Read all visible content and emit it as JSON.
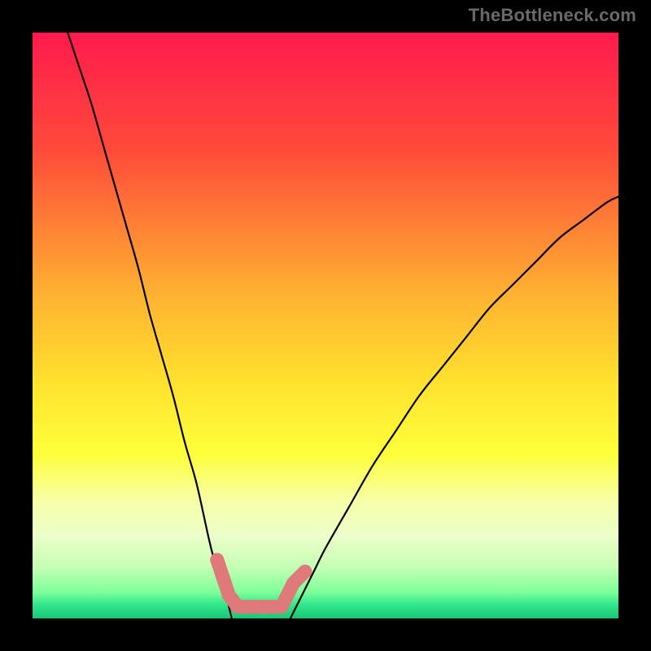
{
  "watermark": "TheBottleneck.com",
  "chart_data": {
    "type": "line",
    "title": "",
    "xlabel": "",
    "ylabel": "",
    "xlim": [
      0,
      100
    ],
    "ylim": [
      0,
      100
    ],
    "grid": false,
    "series": [
      {
        "name": "left-curve",
        "color": "#000000",
        "x": [
          6,
          8,
          10,
          12,
          14,
          16,
          18,
          20,
          22,
          24,
          26,
          28,
          30,
          31,
          32,
          33,
          34
        ],
        "y": [
          100,
          94,
          88,
          81,
          74,
          67,
          60,
          52,
          45,
          38,
          30,
          23,
          14,
          10,
          7,
          4,
          0
        ]
      },
      {
        "name": "right-curve",
        "color": "#000000",
        "x": [
          44,
          46,
          48,
          50,
          54,
          58,
          62,
          66,
          70,
          74,
          78,
          82,
          86,
          90,
          94,
          98,
          100
        ],
        "y": [
          0,
          4,
          8,
          12,
          19,
          26,
          32,
          38,
          43,
          48,
          53,
          57,
          61,
          65,
          68,
          71,
          72
        ]
      },
      {
        "name": "floor-dots",
        "color": "#e07a7a",
        "x": [
          31.5,
          32.5,
          33.5,
          35,
          37,
          39,
          41,
          42.5,
          43.5,
          44.5,
          46.5
        ],
        "y": [
          10,
          7,
          4,
          2,
          2,
          2,
          2,
          2,
          4,
          6,
          8
        ]
      }
    ],
    "background_gradient": {
      "stops": [
        {
          "offset": 0.0,
          "color": "#ff1a4d"
        },
        {
          "offset": 0.2,
          "color": "#ff4a3a"
        },
        {
          "offset": 0.45,
          "color": "#ffb331"
        },
        {
          "offset": 0.6,
          "color": "#ffe22e"
        },
        {
          "offset": 0.72,
          "color": "#feff3a"
        },
        {
          "offset": 0.8,
          "color": "#f7ffa8"
        },
        {
          "offset": 0.86,
          "color": "#ecffca"
        },
        {
          "offset": 0.91,
          "color": "#c7ffb4"
        },
        {
          "offset": 0.955,
          "color": "#7fff9a"
        },
        {
          "offset": 0.975,
          "color": "#35e98d"
        },
        {
          "offset": 1.0,
          "color": "#18c678"
        }
      ]
    }
  }
}
